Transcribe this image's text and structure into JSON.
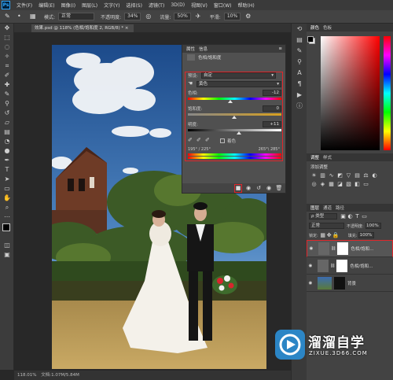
{
  "app": {
    "logo": "Ps"
  },
  "menu": [
    "文件(F)",
    "编辑(E)",
    "图像(I)",
    "图层(L)",
    "文字(Y)",
    "选择(S)",
    "滤镜(T)",
    "3D(D)",
    "视图(V)",
    "窗口(W)",
    "帮助(H)"
  ],
  "options_bar": {
    "mode_label": "模式:",
    "mode_value": "正常",
    "opacity_label": "不透明度:",
    "opacity_value": "34%",
    "flow_label": "流量:",
    "flow_value": "50%",
    "smooth_label": "平滑:",
    "smooth_value": "10%"
  },
  "document": {
    "tab_title": "效果.psd @ 118% (色相/饱和度 2, RGB/8) *",
    "status_zoom": "118.01%",
    "status_doc": "文档:1.07M/5.84M"
  },
  "properties": {
    "tab_properties": "属性",
    "tab_info": "信息",
    "title": "色相/饱和度",
    "preset_label": "预设:",
    "preset_value": "自定",
    "channel_value": "黄色",
    "hue_label": "色相:",
    "hue_value": "-12",
    "saturation_label": "饱和度:",
    "saturation_value": "0",
    "lightness_label": "明度:",
    "lightness_value": "+11",
    "colorize_label": "着色",
    "range_left": "195° / 225°",
    "range_right": "265°\\ 285°"
  },
  "right_panels": {
    "color_tabs": [
      "颜色",
      "色板"
    ],
    "adjust_tabs": [
      "调整",
      "样式"
    ],
    "adjust_hint": "添加调整",
    "layers_tabs": [
      "图层",
      "通道",
      "路径"
    ],
    "filter_label": "ρ 类型",
    "blend_value": "正常",
    "opacity_label": "不透明度:",
    "opacity_value": "100%",
    "lock_label": "锁定:",
    "fill_label": "填充:",
    "fill_value": "100%",
    "layers": [
      {
        "name": "色相/饱和..."
      },
      {
        "name": "色相/饱和..."
      },
      {
        "name": "背景"
      }
    ]
  },
  "watermark": {
    "brand": "溜溜自学",
    "url": "ZIXUE.3D66.COM"
  },
  "colors": {
    "accent_red": "#e0262b",
    "ps_blue": "#31a8ff",
    "panel": "#434343"
  }
}
